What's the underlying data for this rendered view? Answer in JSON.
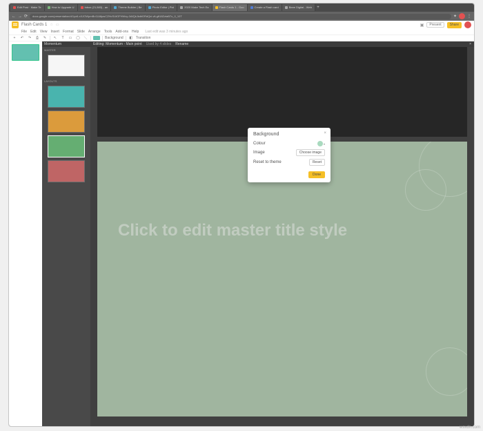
{
  "tabs": [
    {
      "label": "Edit Post · Make Te",
      "color": "#d33"
    },
    {
      "label": "How to Upgrade U",
      "color": "#6a6"
    },
    {
      "label": "Inbox (21,583) - an",
      "color": "#d33"
    },
    {
      "label": "Theme Builder | Be",
      "color": "#39c"
    },
    {
      "label": "Photo Editor | Pixl",
      "color": "#39c"
    },
    {
      "label": "2020 Make Tech Ea",
      "color": "#999"
    },
    {
      "label": "Flash Cards 1 - Goo",
      "color": "#f4b400",
      "active": true
    },
    {
      "label": "Create a Flash card",
      "color": "#36c"
    },
    {
      "label": "Beee Digital - Web",
      "color": "#999"
    }
  ],
  "url": "docs.google.com/presentation/d/1yx6-xXJOWpmBr41A8pwCZHcSUtOFHWxy-0AfQkJkdhDRdQxi-vlLgft18ZztaB7x_0_10T",
  "doc": {
    "title": "Flash Cards 1",
    "menus": [
      "File",
      "Edit",
      "View",
      "Insert",
      "Format",
      "Slide",
      "Arrange",
      "Tools",
      "Add-ons",
      "Help"
    ],
    "info": "Last edit was 3 minutes ago",
    "present": "Present",
    "share": "Share"
  },
  "toolbar": {
    "bg": "Background",
    "tr": "Transition"
  },
  "theme": {
    "title": "Momentum",
    "sub": "MASTER",
    "sub2": "LAYOUTS"
  },
  "canvas": {
    "editing": "Editing: Momentum - Main point",
    "used": "Used by 4 slides",
    "rename": "Rename"
  },
  "slide": {
    "text": "Click to edit master title style"
  },
  "dialog": {
    "title": "Background",
    "colour": "Colour",
    "image": "Image",
    "choose": "Choose image",
    "reset": "Reset to theme",
    "resetBtn": "Reset",
    "done": "Done",
    "swatch": "#9bd4b4"
  },
  "watermark": "wsxdn.com"
}
